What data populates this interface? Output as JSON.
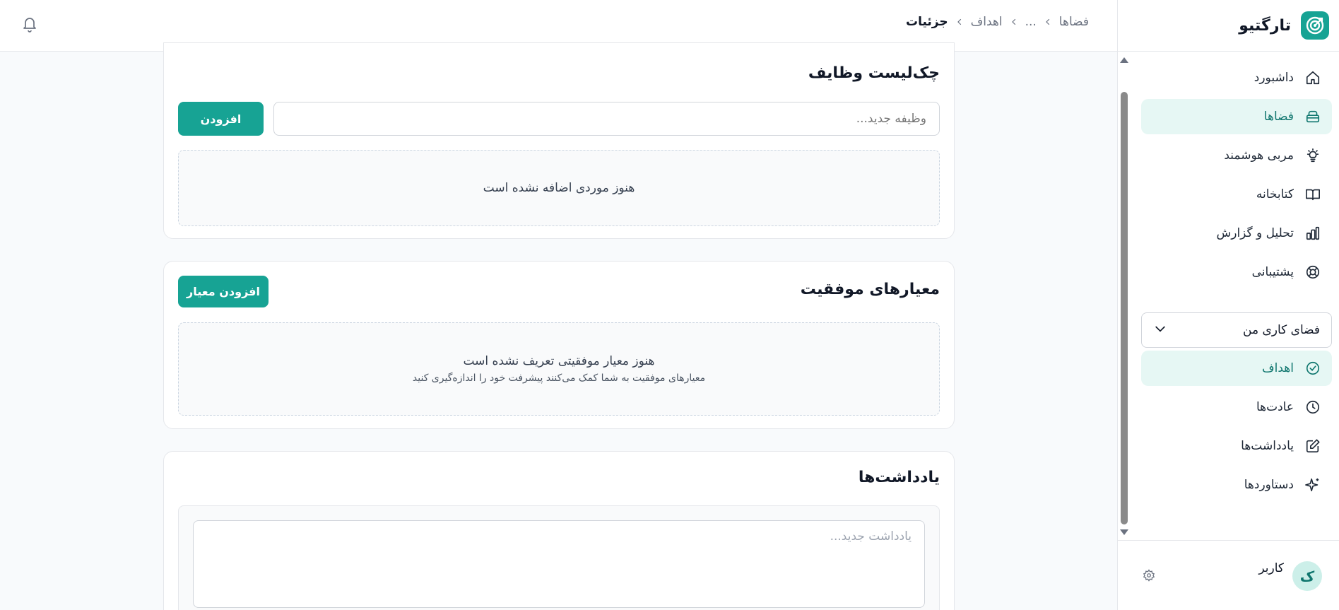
{
  "brand": {
    "name": "تارگتیو"
  },
  "sidebar": {
    "items": [
      {
        "label": "داشبورد",
        "icon": "home-icon",
        "active": false
      },
      {
        "label": "فضاها",
        "icon": "layers-icon",
        "active": true
      },
      {
        "label": "مربی هوشمند",
        "icon": "lightbulb-icon",
        "active": false
      },
      {
        "label": "کتابخانه",
        "icon": "book-icon",
        "active": false
      },
      {
        "label": "تحلیل و گزارش",
        "icon": "bar-chart-icon",
        "active": false
      },
      {
        "label": "پشتیبانی",
        "icon": "lifebuoy-icon",
        "active": false
      }
    ],
    "workspace": {
      "selected": "فضای کاری من"
    },
    "sub_items": [
      {
        "label": "اهداف",
        "icon": "check-circle-icon",
        "active": true
      },
      {
        "label": "عادت‌ها",
        "icon": "clock-icon",
        "active": false
      },
      {
        "label": "یادداشت‌ها",
        "icon": "edit-icon",
        "active": false
      },
      {
        "label": "دستاوردها",
        "icon": "sparkles-icon",
        "active": false
      }
    ],
    "user": {
      "avatar_letter": "ک",
      "name": "کاربر"
    }
  },
  "header": {
    "breadcrumb": [
      "فضاها",
      "...",
      "اهداف",
      "جزئیات"
    ]
  },
  "checklist": {
    "title": "چک‌لیست وظایف",
    "input_placeholder": "وظیفه جدید...",
    "add_label": "افزودن",
    "empty_text": "هنوز موردی اضافه نشده است"
  },
  "criteria": {
    "title": "معیارهای موفقیت",
    "add_label": "افزودن معیار",
    "empty_title": "هنوز معیار موفقیتی تعریف نشده است",
    "empty_sub": "معیارهای موفقیت به شما کمک می‌کنند پیشرفت خود را اندازه‌گیری کنید"
  },
  "notes": {
    "title": "یادداشت‌ها",
    "placeholder": "یادداشت جدید..."
  },
  "colors": {
    "accent": "#17a394",
    "active_bg": "#e6f7f4",
    "page_bg": "#f8fafc"
  }
}
